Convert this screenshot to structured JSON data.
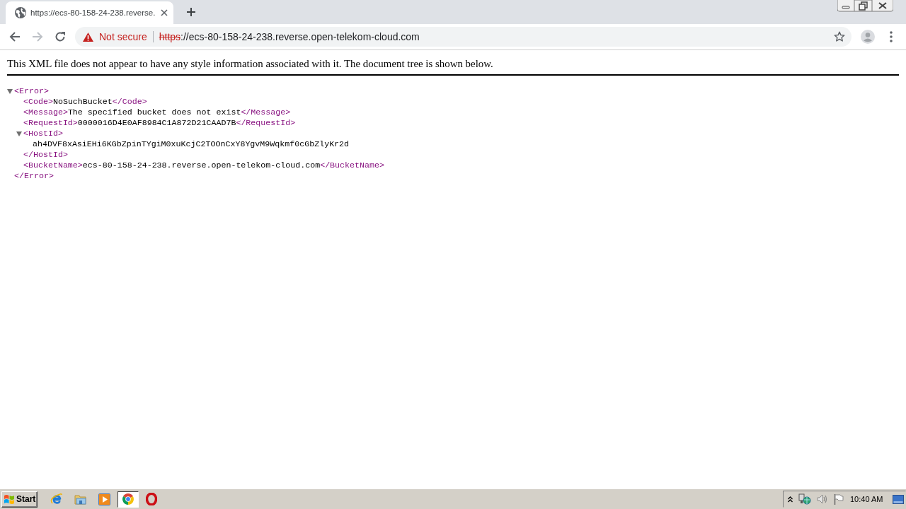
{
  "browser": {
    "tabs": [
      {
        "title": "https://ecs-80-158-24-238.reverse.",
        "selected": true
      }
    ],
    "nav": [
      {
        "kind": "back",
        "disabled": false
      },
      {
        "kind": "forward",
        "disabled": true
      },
      {
        "kind": "reload",
        "disabled": false
      }
    ],
    "address": {
      "secure": false,
      "security": "Not secure",
      "scheme": "https",
      "rest": "://ecs-80-158-24-238.reverse.open-telekom-cloud.com"
    }
  },
  "page": {
    "notice": "This XML file does not appear to have any style information associated with it. The document tree is shown below.",
    "tree": [
      {
        "kind": "element",
        "open": "<Error>",
        "close": "</Error>",
        "expanded": true,
        "children": [
          {
            "kind": "leaf",
            "open": "<Code>",
            "text": "NoSuchBucket",
            "close": "</Code>"
          },
          {
            "kind": "leaf",
            "open": "<Message>",
            "text": "The specified bucket does not exist",
            "close": "</Message>"
          },
          {
            "kind": "leaf",
            "open": "<RequestId>",
            "text": "0000016D4E0AF8984C1A872D21CAAD7B",
            "close": "</RequestId>"
          },
          {
            "kind": "element",
            "open": "<HostId>",
            "close": "</HostId>",
            "expanded": true,
            "children": [
              {
                "kind": "text",
                "text": "ah4DVF8xAsiEHi6KGbZpinTYgiM0xuKcjC2TOOnCxY8YgvM9Wqkmf0cGbZlyKr2d"
              }
            ]
          },
          {
            "kind": "leaf",
            "open": "<BucketName>",
            "text": "ecs-80-158-24-238.reverse.open-telekom-cloud.com",
            "close": "</BucketName>"
          }
        ]
      }
    ]
  },
  "taskbar": {
    "start": "Start",
    "apps": [
      {
        "kind": "letter-e",
        "selected": false
      },
      {
        "kind": "folder",
        "selected": false
      },
      {
        "kind": "play",
        "selected": false
      },
      {
        "kind": "ring",
        "selected": true
      },
      {
        "kind": "oval",
        "selected": false
      }
    ],
    "clock": "10:40 AM"
  }
}
